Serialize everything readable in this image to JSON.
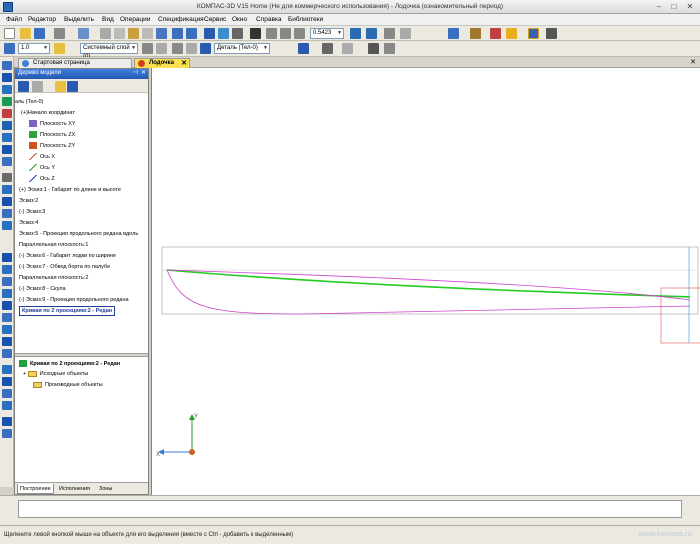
{
  "window": {
    "title": "КОМПАС-3D V15 Home (Не для коммерческого использования) - Лодочка (ознакомительный период)",
    "minimize": "–",
    "maximize": "□",
    "close": "✕"
  },
  "menu": [
    "Файл",
    "Редактор",
    "Выделить",
    "Вид",
    "Операции",
    "Спецификация",
    "Сервис",
    "Окно",
    "Справка",
    "Библиотеки"
  ],
  "toolbar": {
    "zoom_value": "0.5423",
    "line_weight": "1.0",
    "layer": "Системный слой (0)",
    "part": "Деталь (Тел-0)"
  },
  "tabs": {
    "start_page": "Стартовая страница",
    "document": "Лодочка"
  },
  "tree_panel": {
    "title": "Дерево модели",
    "pin": "⊣",
    "close": "✕",
    "items": [
      "аль (Тел-0)",
      "(+)Начало координат",
      "Плоскость XY",
      "Плоскость ZX",
      "Плоскость ZY",
      "Ось X",
      "Ось Y",
      "Ось Z",
      "(+) Эскиз:1 - Габарит по длине и высоте",
      "Эскиз:2",
      "(-) Эскиз:3",
      "Эскиз:4",
      "Эскиз:5 - Проекция продольного редана вдоль",
      "Параллельная плоскость:1",
      "(-) Эскиз:6 - Габарит лодки по ширине",
      "(-) Эскиз:7 - Обвод борта по палубе",
      "Параллельная плоскость:2",
      "(-) Эскиз:8 - Скула",
      "(-) Эскиз:9 - Проекция продольного редана"
    ],
    "selected_item": "Кривая по 2 проекциям:2 - Редан"
  },
  "lower_panel": {
    "title": "Кривая по 2 проекциям:2 - Редан",
    "expand": "+",
    "items": [
      "Исходные объекты",
      "Производные объекты"
    ]
  },
  "panel_tabs": [
    "Построение",
    "Исполнения",
    "Зоны"
  ],
  "axes": {
    "y": "Y",
    "x": "X"
  },
  "status": {
    "text": "Щелкните левой кнопкой мыши на объекте для его выделения (вместе с Ctrl - добавить к выделенным)",
    "watermark": "www.kompas.ru"
  },
  "colors": {
    "tree_header": "#2458b0",
    "green_curve": "#22cc22",
    "magenta_curve": "#cc44cc",
    "active_tab": "#f8e050"
  }
}
